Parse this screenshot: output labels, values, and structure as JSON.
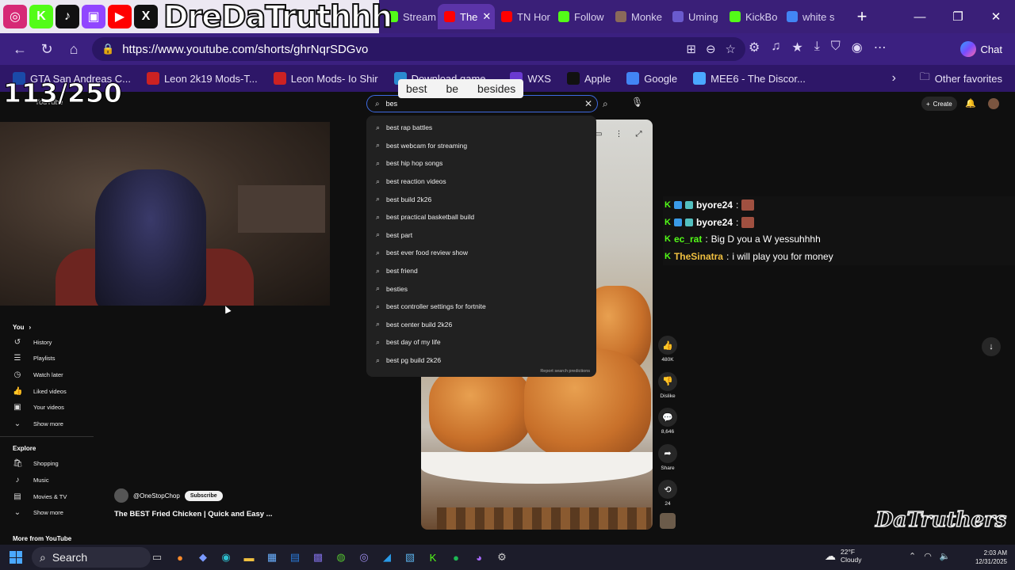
{
  "overlay": {
    "brand": "DreDaTruthhh",
    "social_icons": [
      {
        "icon": "instagram-icon",
        "glyph": "◎",
        "color": "#d62976"
      },
      {
        "icon": "kick-icon",
        "glyph": "K",
        "color": "#53fc18"
      },
      {
        "icon": "tiktok-icon",
        "glyph": "♪",
        "color": "#111111"
      },
      {
        "icon": "twitch-icon",
        "glyph": "▣",
        "color": "#9146ff"
      },
      {
        "icon": "youtube-icon",
        "glyph": "▶",
        "color": "#ff0000"
      },
      {
        "icon": "x-icon",
        "glyph": "X",
        "color": "#111111"
      }
    ],
    "counter": "113/250",
    "watermark": "DaTruthers"
  },
  "browser": {
    "tabs": [
      {
        "label": "Stream",
        "color": "#53fc18",
        "active": false
      },
      {
        "label": "The",
        "color": "#ff0000",
        "active": true
      },
      {
        "label": "TN Hor",
        "color": "#ff0000",
        "active": false
      },
      {
        "label": "Follow",
        "color": "#53fc18",
        "active": false
      },
      {
        "label": "Monke",
        "color": "#8a6a5a",
        "active": false
      },
      {
        "label": "Uming",
        "color": "#6a5acd",
        "active": false
      },
      {
        "label": "KickBo",
        "color": "#53fc18",
        "active": false
      },
      {
        "label": "white s",
        "color": "#4285f4",
        "active": false
      }
    ],
    "url": "https://www.youtube.com/shorts/ghrNqrSDGvo",
    "chat_label": "Chat",
    "bookmarks": [
      {
        "label": "GTA San Andreas C...",
        "color": "#1a4aa8"
      },
      {
        "label": "Leon 2k19 Mods-T...",
        "color": "#cc2222"
      },
      {
        "label": "Leon Mods- Io Shir",
        "color": "#cc2222"
      },
      {
        "label": "Download game...",
        "color": "#2a8ad0"
      },
      {
        "label": "WXS",
        "color": "#6a3ad0"
      },
      {
        "label": "Apple",
        "color": "#111111"
      },
      {
        "label": "Google",
        "color": "#4285f4"
      },
      {
        "label": "MEE6 - The Discor...",
        "color": "#4aa8ff"
      }
    ],
    "other_favorites": "Other favorites",
    "spell_suggestions": [
      "best",
      "be",
      "besides"
    ]
  },
  "youtube": {
    "logo_text": "YouTube",
    "search_value": "bes",
    "create_label": "Create",
    "suggestions": [
      "best rap battles",
      "best webcam for streaming",
      "best hip hop songs",
      "best reaction videos",
      "best build 2k26",
      "best practical basketball build",
      "best part",
      "best ever food review show",
      "best friend",
      "besties",
      "best controller settings for fortnite",
      "best center build 2k26",
      "best day of my life",
      "best pg build 2k26"
    ],
    "report_label": "Report search predictions",
    "sidebar": {
      "you_heading": "You",
      "you_items": [
        {
          "label": "History",
          "icon": "history-icon",
          "glyph": "↺"
        },
        {
          "label": "Playlists",
          "icon": "playlists-icon",
          "glyph": "☰"
        },
        {
          "label": "Watch later",
          "icon": "clock-icon",
          "glyph": "◷"
        },
        {
          "label": "Liked videos",
          "icon": "thumb-up-icon",
          "glyph": "👍"
        },
        {
          "label": "Your videos",
          "icon": "video-icon",
          "glyph": "▣"
        },
        {
          "label": "Show more",
          "icon": "chevron-down-icon",
          "glyph": "⌄"
        }
      ],
      "explore_heading": "Explore",
      "explore_items": [
        {
          "label": "Shopping",
          "icon": "shopping-icon",
          "glyph": "🛍"
        },
        {
          "label": "Music",
          "icon": "music-icon",
          "glyph": "♪"
        },
        {
          "label": "Movies & TV",
          "icon": "movies-icon",
          "glyph": "▤"
        },
        {
          "label": "Show more",
          "icon": "chevron-down-icon",
          "glyph": "⌄"
        }
      ],
      "more_heading": "More from YouTube"
    },
    "short": {
      "channel": "@OneStopChop",
      "subscribe": "Subscribe",
      "title": "The BEST Fried Chicken | Quick and Easy ..."
    },
    "actions": [
      {
        "icon": "thumb-up-icon",
        "glyph": "👍",
        "label": "480K"
      },
      {
        "icon": "thumb-down-icon",
        "glyph": "👎",
        "label": "Dislike"
      },
      {
        "icon": "comment-icon",
        "glyph": "💬",
        "label": "8,646"
      },
      {
        "icon": "share-icon",
        "glyph": "➦",
        "label": "Share"
      },
      {
        "icon": "remix-icon",
        "glyph": "⟲",
        "label": "24"
      }
    ]
  },
  "chat": [
    {
      "user": "byore24",
      "text": "",
      "color": "#ffffff",
      "emote": true
    },
    {
      "user": "byore24",
      "text": "",
      "color": "#ffffff",
      "emote": true
    },
    {
      "user": "ec_rat",
      "text": "Big D you a W yessuhhhh",
      "color": "#53fc18",
      "emote": false
    },
    {
      "user": "TheSinatra",
      "text": "i will play you for money",
      "color": "#f0c040",
      "emote": false
    }
  ],
  "taskbar": {
    "search_label": "Search",
    "weather_temp": "22°F",
    "weather_cond": "Cloudy",
    "time": "2:03 AM",
    "date": "12/31/2025"
  }
}
